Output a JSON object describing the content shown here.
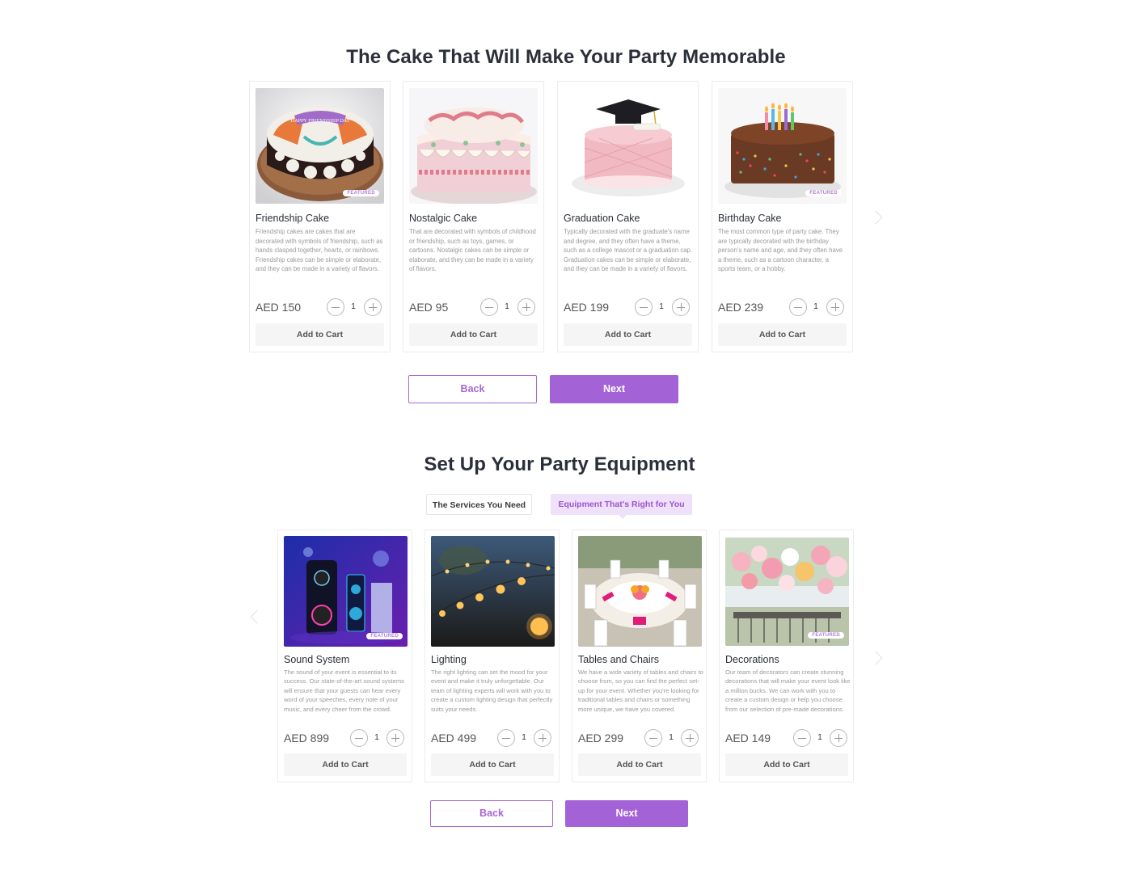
{
  "cakes_section": {
    "title": "The Cake That Will Make Your Party Memorable",
    "items": [
      {
        "name": "Friendship Cake",
        "description": "Friendship cakes are cakes that are decorated with symbols of friendship, such as hands clasped together, hearts, or rainbows. Friendship cakes can be simple or elaborate, and they can be made in a variety of flavors.",
        "price": "AED 150",
        "qty": "1",
        "cart": "Add to Cart",
        "badge": "FEATURED",
        "icon": "friendship-cake-image",
        "image_text": "HAPPY FRIENDSHIP DAY"
      },
      {
        "name": "Nostalgic Cake",
        "description": "That are decorated with symbols of childhood or friendship, such as toys, games, or cartoons. Nostalgic cakes can be simple or elaborate, and they can be made in a variety of flavors.",
        "price": "AED 95",
        "qty": "1",
        "cart": "Add to Cart",
        "icon": "nostalgic-cake-image"
      },
      {
        "name": "Graduation Cake",
        "description": "Typically decorated with the graduate's name and degree, and they often have a theme, such as a college mascot or a graduation cap. Graduation cakes can be simple or elaborate, and they can be made in a variety of flavors.",
        "price": "AED 199",
        "qty": "1",
        "cart": "Add to Cart",
        "icon": "graduation-cake-image"
      },
      {
        "name": "Birthday Cake",
        "description": "The most common type of party cake. They are typically decorated with the birthday person's name and age, and they often have a theme, such as a cartoon character, a sports team, or a hobby.",
        "price": "AED 239",
        "qty": "1",
        "cart": "Add to Cart",
        "badge": "FEATURED",
        "icon": "birthday-cake-image"
      }
    ],
    "back": "Back",
    "next": "Next"
  },
  "equipment_section": {
    "title": "Set Up Your Party Equipment",
    "tabs": [
      {
        "label": "The Services You Need",
        "active": false
      },
      {
        "label": "Equipment That's Right for You",
        "active": true
      }
    ],
    "items": [
      {
        "name": "Sound System",
        "description": "The sound of your event is essential to its success. Our state-of-the-art sound systems will ensure that your guests can hear every word of your speeches, every note of your music, and every cheer from the crowd.",
        "price": "AED 899",
        "qty": "1",
        "cart": "Add to Cart",
        "badge": "FEATURED",
        "icon": "sound-system-image"
      },
      {
        "name": "Lighting",
        "description": "The right lighting can set the mood for your event and make it truly unforgettable. Our team of lighting experts will work with you to create a custom lighting design that perfectly suits your needs.",
        "price": "AED 499",
        "qty": "1",
        "cart": "Add to Cart",
        "icon": "lighting-image"
      },
      {
        "name": "Tables and Chairs",
        "description": "We have a wide variety of tables and chairs to choose from, so you can find the perfect set-up for your event. Whether you're looking for traditional tables and chairs or something more unique, we have you covered.",
        "price": "AED 299",
        "qty": "1",
        "cart": "Add to Cart",
        "icon": "tables-chairs-image"
      },
      {
        "name": "Decorations",
        "description": "Our team of decorators can create stunning decorations that will make your event look like a million bucks. We can work with you to create a custom design or help you choose from our selection of pre-made decorations.",
        "price": "AED 149",
        "qty": "1",
        "cart": "Add to Cart",
        "badge": "FEATURED",
        "icon": "decorations-image"
      }
    ],
    "back": "Back",
    "next": "Next"
  },
  "colors": {
    "accent": "#a362d6",
    "accent_light": "#efe1fa",
    "text_dark": "#2b2f3a",
    "text_muted": "#9a9a9a"
  }
}
